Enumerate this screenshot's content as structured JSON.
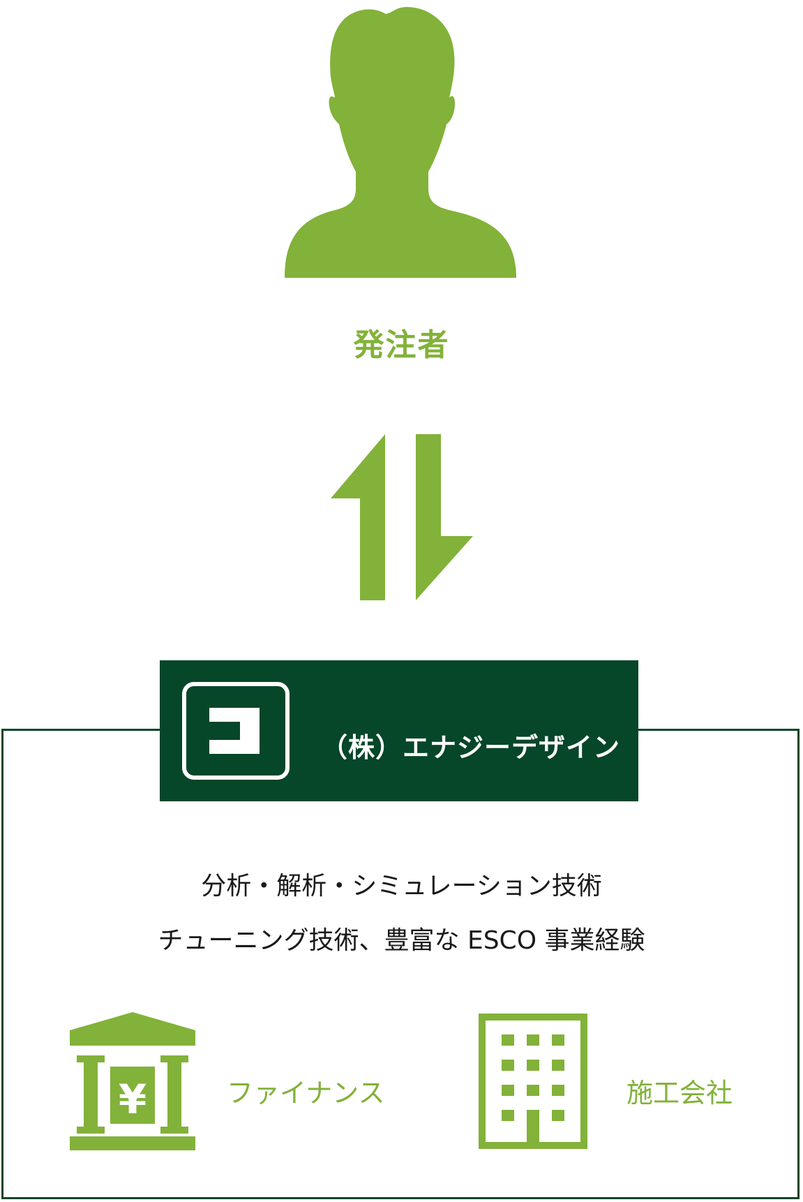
{
  "client": {
    "label": "発注者",
    "icon": "person-icon"
  },
  "exchange": {
    "icon": "bidirectional-arrows-icon"
  },
  "company": {
    "name": "（株）エナジーデザイン",
    "logo": "company-logo-icon"
  },
  "description": {
    "line1": "分析・解析・シミュレーション技術",
    "line2": "チューニング技術、豊富な ESCO 事業経験"
  },
  "partners": [
    {
      "label": "ファイナンス",
      "icon": "bank-yen-icon"
    },
    {
      "label": "施工会社",
      "icon": "building-icon"
    }
  ],
  "colors": {
    "accent": "#82b239",
    "dark": "#064629",
    "text": "#1a1a1a"
  }
}
